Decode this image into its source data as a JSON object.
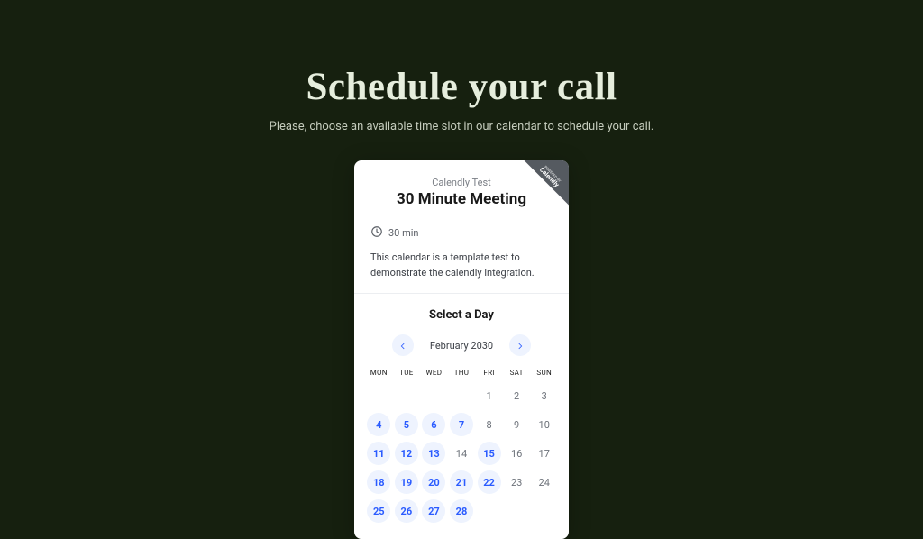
{
  "page": {
    "title": "Schedule your call",
    "subtitle": "Please, choose an available time slot in our calendar to schedule your call."
  },
  "badge": {
    "line1": "POWERED BY",
    "line2": "Calendly"
  },
  "meeting": {
    "host": "Calendly Test",
    "title": "30 Minute Meeting",
    "duration": "30 min",
    "description": "This calendar is a template test to demonstrate the calendly integration."
  },
  "calendar": {
    "heading": "Select a Day",
    "month_label": "February 2030",
    "dow": [
      "MON",
      "TUE",
      "WED",
      "THU",
      "FRI",
      "SAT",
      "SUN"
    ],
    "weeks": [
      [
        {
          "n": "",
          "state": "empty"
        },
        {
          "n": "",
          "state": "empty"
        },
        {
          "n": "",
          "state": "empty"
        },
        {
          "n": "",
          "state": "empty"
        },
        {
          "n": "1",
          "state": "unavail"
        },
        {
          "n": "2",
          "state": "unavail"
        },
        {
          "n": "3",
          "state": "unavail"
        }
      ],
      [
        {
          "n": "4",
          "state": "avail"
        },
        {
          "n": "5",
          "state": "avail"
        },
        {
          "n": "6",
          "state": "avail"
        },
        {
          "n": "7",
          "state": "avail"
        },
        {
          "n": "8",
          "state": "unavail"
        },
        {
          "n": "9",
          "state": "unavail"
        },
        {
          "n": "10",
          "state": "unavail"
        }
      ],
      [
        {
          "n": "11",
          "state": "avail"
        },
        {
          "n": "12",
          "state": "avail"
        },
        {
          "n": "13",
          "state": "avail"
        },
        {
          "n": "14",
          "state": "unavail"
        },
        {
          "n": "15",
          "state": "avail"
        },
        {
          "n": "16",
          "state": "unavail"
        },
        {
          "n": "17",
          "state": "unavail"
        }
      ],
      [
        {
          "n": "18",
          "state": "avail"
        },
        {
          "n": "19",
          "state": "avail"
        },
        {
          "n": "20",
          "state": "avail"
        },
        {
          "n": "21",
          "state": "avail"
        },
        {
          "n": "22",
          "state": "avail"
        },
        {
          "n": "23",
          "state": "unavail"
        },
        {
          "n": "24",
          "state": "unavail"
        }
      ],
      [
        {
          "n": "25",
          "state": "avail"
        },
        {
          "n": "26",
          "state": "avail"
        },
        {
          "n": "27",
          "state": "avail"
        },
        {
          "n": "28",
          "state": "avail"
        },
        {
          "n": "",
          "state": "empty"
        },
        {
          "n": "",
          "state": "empty"
        },
        {
          "n": "",
          "state": "empty"
        }
      ]
    ]
  }
}
